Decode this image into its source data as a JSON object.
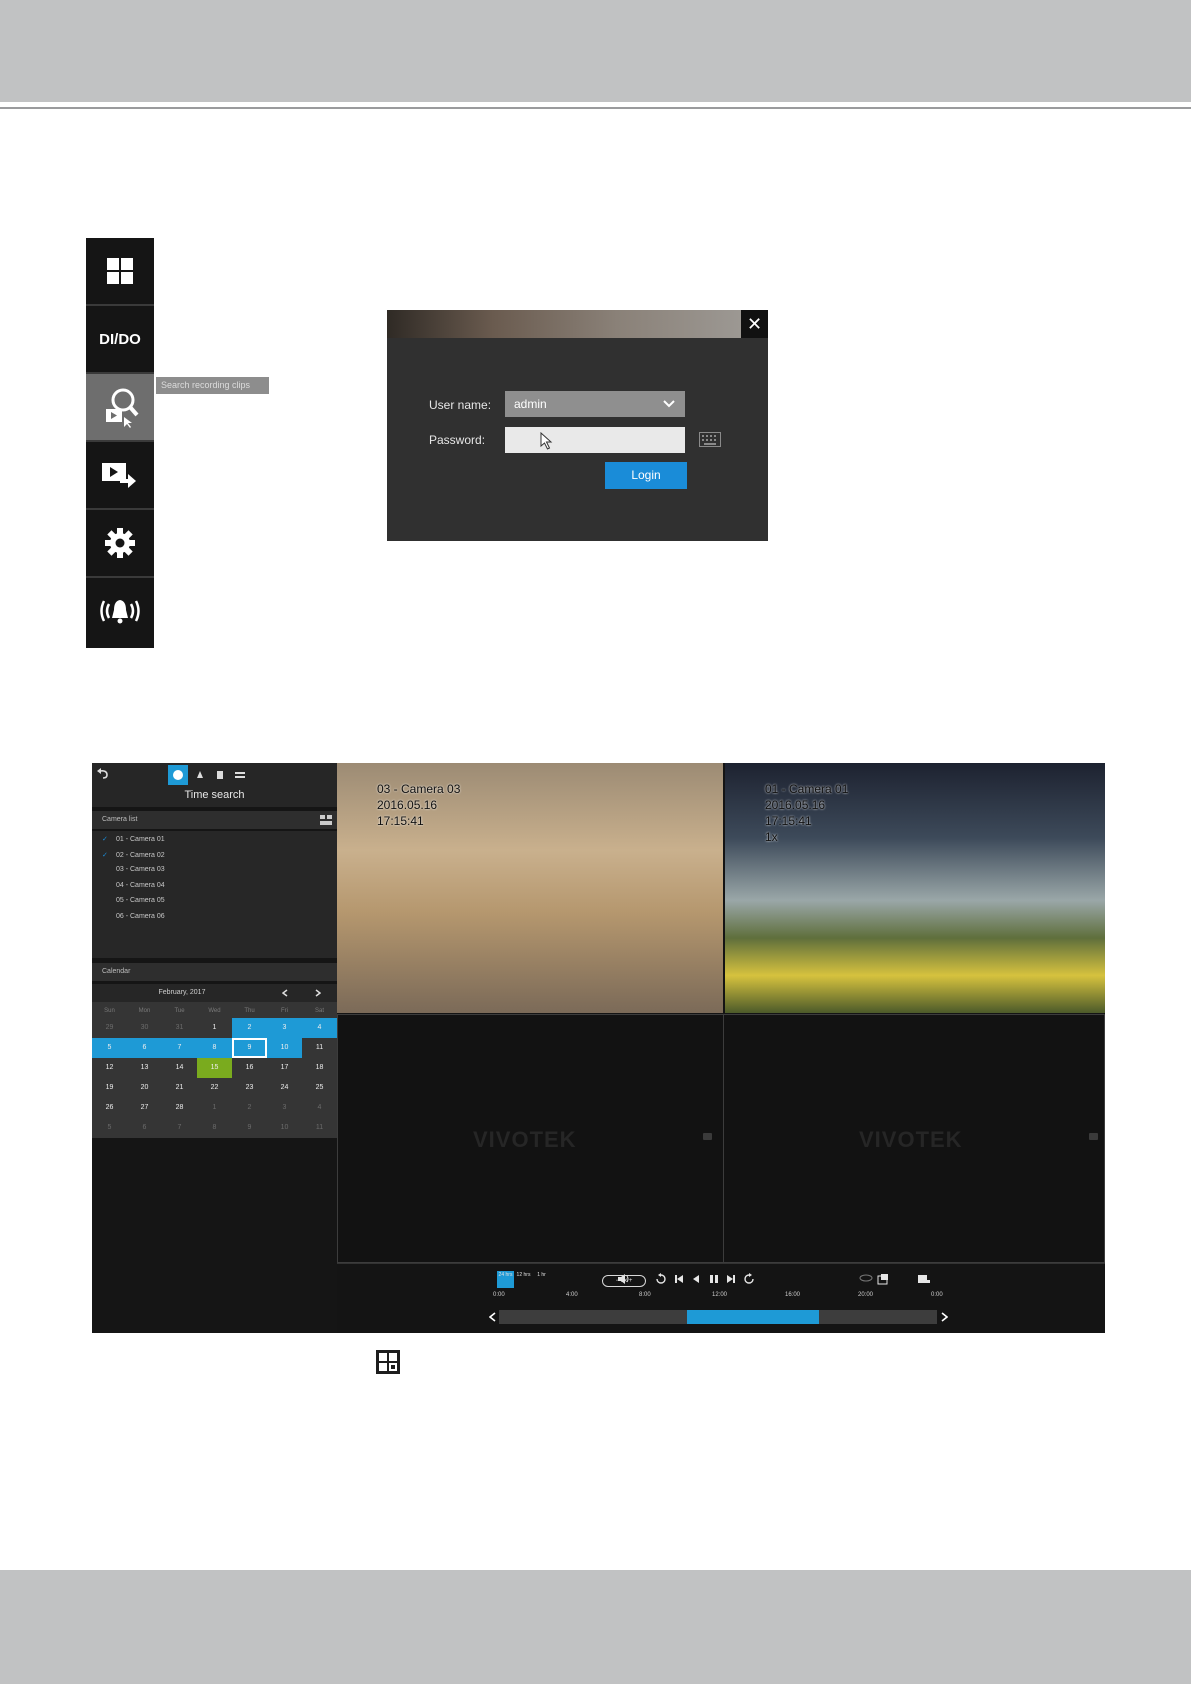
{
  "toolbar": {
    "dido_label": "DI/DO",
    "tooltip": "Search recording clips"
  },
  "login": {
    "username_label": "User name:",
    "username_value": "admin",
    "password_label": "Password:",
    "login_label": "Login",
    "close_glyph": "✕"
  },
  "playback": {
    "title": "Time search",
    "camera_list_header": "Camera list",
    "cameras": [
      {
        "label": "01 - Camera 01",
        "checked": true
      },
      {
        "label": "02 - Camera 02",
        "checked": true
      },
      {
        "label": "03 - Camera 03",
        "checked": false
      },
      {
        "label": "04 - Camera 04",
        "checked": false
      },
      {
        "label": "05 - Camera 05",
        "checked": false
      },
      {
        "label": "06 - Camera 06",
        "checked": false
      }
    ],
    "calendar_header": "Calendar",
    "calendar_month": "February, 2017",
    "weekdays": [
      "Sun",
      "Mon",
      "Tue",
      "Wed",
      "Thu",
      "Fri",
      "Sat"
    ],
    "days": [
      [
        "29",
        "30",
        "31",
        "1",
        "2",
        "3",
        "4"
      ],
      [
        "5",
        "6",
        "7",
        "8",
        "9",
        "10",
        "11"
      ],
      [
        "12",
        "13",
        "14",
        "15",
        "16",
        "17",
        "18"
      ],
      [
        "19",
        "20",
        "21",
        "22",
        "23",
        "24",
        "25"
      ],
      [
        "26",
        "27",
        "28",
        "1",
        "2",
        "3",
        "4"
      ],
      [
        "5",
        "6",
        "7",
        "8",
        "9",
        "10",
        "11"
      ]
    ],
    "osd_left": "03 - Camera 03\n2016.05.16\n17:15:41",
    "osd_right": "01 - Camera 01\n2016.05.16\n17:15:41\n1x",
    "watermark": "VIVOTEK",
    "scale_options": [
      "24 hrs",
      "12 hrs",
      "1 hr"
    ],
    "speed": "1x",
    "time_ticks": [
      "0:00",
      "4:00",
      "8:00",
      "12:00",
      "16:00",
      "20:00",
      "0:00"
    ],
    "timeline_range_fraction": [
      0.43,
      0.73
    ]
  }
}
